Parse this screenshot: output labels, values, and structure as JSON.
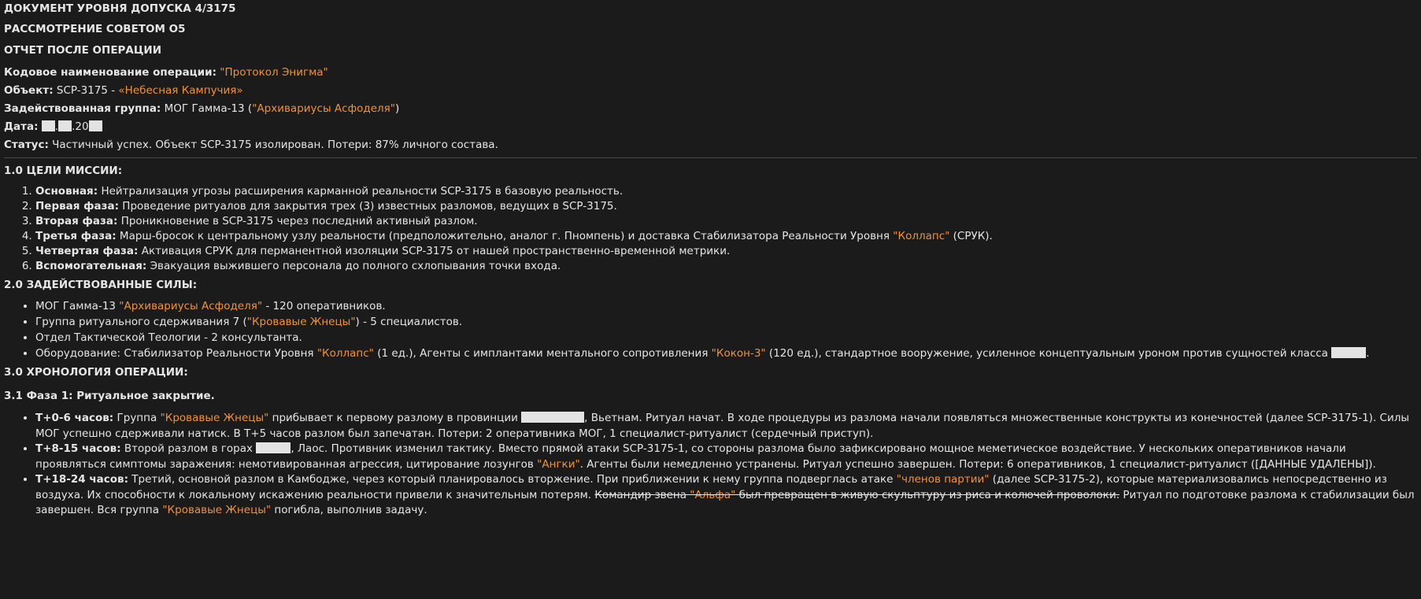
{
  "header": {
    "line1": "ДОКУМЕНТ УРОВНЯ ДОПУСКА 4/3175",
    "line2": "РАССМОТРЕНИЕ СОВЕТОМ О5",
    "line3": "ОТЧЕТ ПОСЛЕ ОПЕРАЦИИ"
  },
  "fields": {
    "codename_label": "Кодовое наименование операции:",
    "codename_value": "\"Протокол Энигма\"",
    "object_label": "Объект:",
    "object_prefix": "SCP-3175 -",
    "object_value": "«Небесная Кампучия»",
    "group_label": "Задействованная группа:",
    "group_prefix": "МОГ Гамма-13 (",
    "group_value": "\"Архивариусы Асфоделя\"",
    "group_suffix": ")",
    "date_label": "Дата:",
    "date_sep1": ".",
    "date_sep2": ".20",
    "status_label": "Статус:",
    "status_value": "Частичный успех. Объект SCP-3175 изолирован. Потери: 87% личного состава."
  },
  "section1": {
    "title": "1.0 ЦЕЛИ МИССИИ:",
    "items": [
      {
        "label": "Основная:",
        "text": "Нейтрализация угрозы расширения карманной реальности SCP-3175 в базовую реальность."
      },
      {
        "label": "Первая фаза:",
        "text": "Проведение ритуалов для закрытия трех (3) известных разломов, ведущих в SCP-3175."
      },
      {
        "label": "Вторая фаза:",
        "text": "Проникновение в SCP-3175 через последний активный разлом."
      },
      {
        "label": "Третья фаза:",
        "text": "Марш-бросок к центральному узлу реальности (предположительно, аналог г. Пномпень) и доставка Стабилизатора Реальности Уровня",
        "highlight": "\"Коллапс\"",
        "tail": "(СРУК)."
      },
      {
        "label": "Четвертая фаза:",
        "text": "Активация СРУК для перманентной изоляции SCP-3175 от нашей пространственно-временной метрики."
      },
      {
        "label": "Вспомогательная:",
        "text": "Эвакуация выжившего персонала до полного схлопывания точки входа."
      }
    ]
  },
  "section2": {
    "title": "2.0 ЗАДЕЙСТВОВАННЫЕ СИЛЫ:",
    "item1_pre": "МОГ Гамма-13",
    "item1_hl": "\"Архивариусы Асфоделя\"",
    "item1_post": "- 120 оперативников.",
    "item2_pre": "Группа ритуального сдерживания 7 (",
    "item2_hl": "\"Кровавые Жнецы\"",
    "item2_post": ") - 5 специалистов.",
    "item3": "Отдел Тактической Теологии - 2 консультанта.",
    "item4_pre": "Оборудование: Стабилизатор Реальности Уровня",
    "item4_hl1": "\"Коллапс\"",
    "item4_mid": "(1 ед.), Агенты с имплантами ментального сопротивления",
    "item4_hl2": "\"Кокон-3\"",
    "item4_post": "(120 ед.), стандартное вооружение, усиленное концептуальным уроном против сущностей класса",
    "item4_end": "."
  },
  "section3": {
    "title": "3.0 ХРОНОЛОГИЯ ОПЕРАЦИИ:",
    "sub_title": "3.1 Фаза 1: Ритуальное закрытие.",
    "t1_label": "T+0-6 часов:",
    "t1_a": "Группа",
    "t1_hl": "\"Кровавые Жнецы\"",
    "t1_b": "прибывает к первому разлому в провинции",
    "t1_c": ", Вьетнам. Ритуал начат. В ходе процедуры из разлома начали появляться множественные конструкты из конечностей (далее SCP-3175-1). Силы МОГ успешно сдерживали натиск. В Т+5 часов разлом был запечатан. Потери: 2 оперативника МОГ, 1 специалист-ритуалист (сердечный приступ).",
    "t2_label": "T+8-15 часов:",
    "t2_a": "Второй разлом в горах",
    "t2_b": ", Лаос. Противник изменил тактику. Вместо прямой атаки SCP-3175-1, со стороны разлома было зафиксировано мощное меметическое воздействие. У нескольких оперативников начали проявляться симптомы заражения: немотивированная агрессия, цитирование лозунгов",
    "t2_hl": "\"Ангки\"",
    "t2_c": ". Агенты были немедленно устранены. Ритуал успешно завершен. Потери: 6 оперативников, 1 специалист-ритуалист ([ДАННЫЕ УДАЛЕНЫ]).",
    "t3_label": "T+18-24 часов:",
    "t3_a": "Третий, основной разлом в Камбодже, через который планировалось вторжение. При приближении к нему группа подверглась атаке",
    "t3_hl": "\"членов партии\"",
    "t3_b": "(далее SCP-3175-2), которые материализовались непосредственно из воздуха. Их способности к локальному искажению реальности привели к значительным потерям.",
    "t3_strike_a": "Командир звена",
    "t3_strike_hl": "\"Альфа\"",
    "t3_strike_b": "был превращен в живую скульптуру из риса и колючей проволоки.",
    "t3_c": "Ритуал по подготовке разлома к стабилизации был завершен. Вся группа",
    "t3_hl2": "\"Кровавые Жнецы\"",
    "t3_d": "погибла, выполнив задачу."
  }
}
